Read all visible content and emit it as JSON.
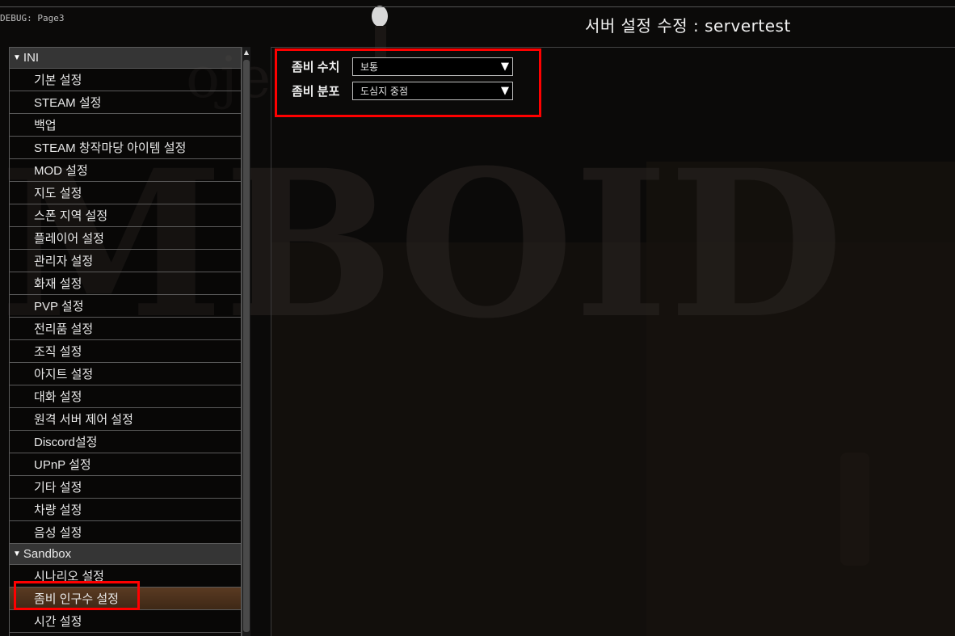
{
  "debug_label": "DEBUG: Page3",
  "window_title": "서버 설정 수정 : servertest",
  "groups": [
    {
      "header": "INI",
      "items": [
        "기본 설정",
        "STEAM 설정",
        "백업",
        "STEAM 창작마당 아이템 설정",
        "MOD 설정",
        "지도 설정",
        "스폰 지역 설정",
        "플레이어 설정",
        "관리자 설정",
        "화재 설정",
        "PVP 설정",
        "전리품 설정",
        "조직 설정",
        "아지트 설정",
        "대화 설정",
        "원격 서버 제어 설정",
        "Discord설정",
        "UPnP 설정",
        "기타 설정",
        "차량 설정",
        "음성 설정"
      ]
    },
    {
      "header": "Sandbox",
      "items": [
        "시나리오 설정",
        "좀비 인구수 설정",
        "시간 설정"
      ],
      "selected_index": 1
    }
  ],
  "settings": {
    "zombie_count": {
      "label": "좀비 수치",
      "value": "보통"
    },
    "zombie_distribution": {
      "label": "좀비 분포",
      "value": "도심지 중점"
    }
  },
  "colors": {
    "highlight": "#ff0000",
    "selected_row": "#5a3a22"
  },
  "icons": {
    "dropdown": "triangle-down-icon",
    "group_toggle": "triangle-down-icon",
    "scroll_up": "triangle-up-icon"
  }
}
